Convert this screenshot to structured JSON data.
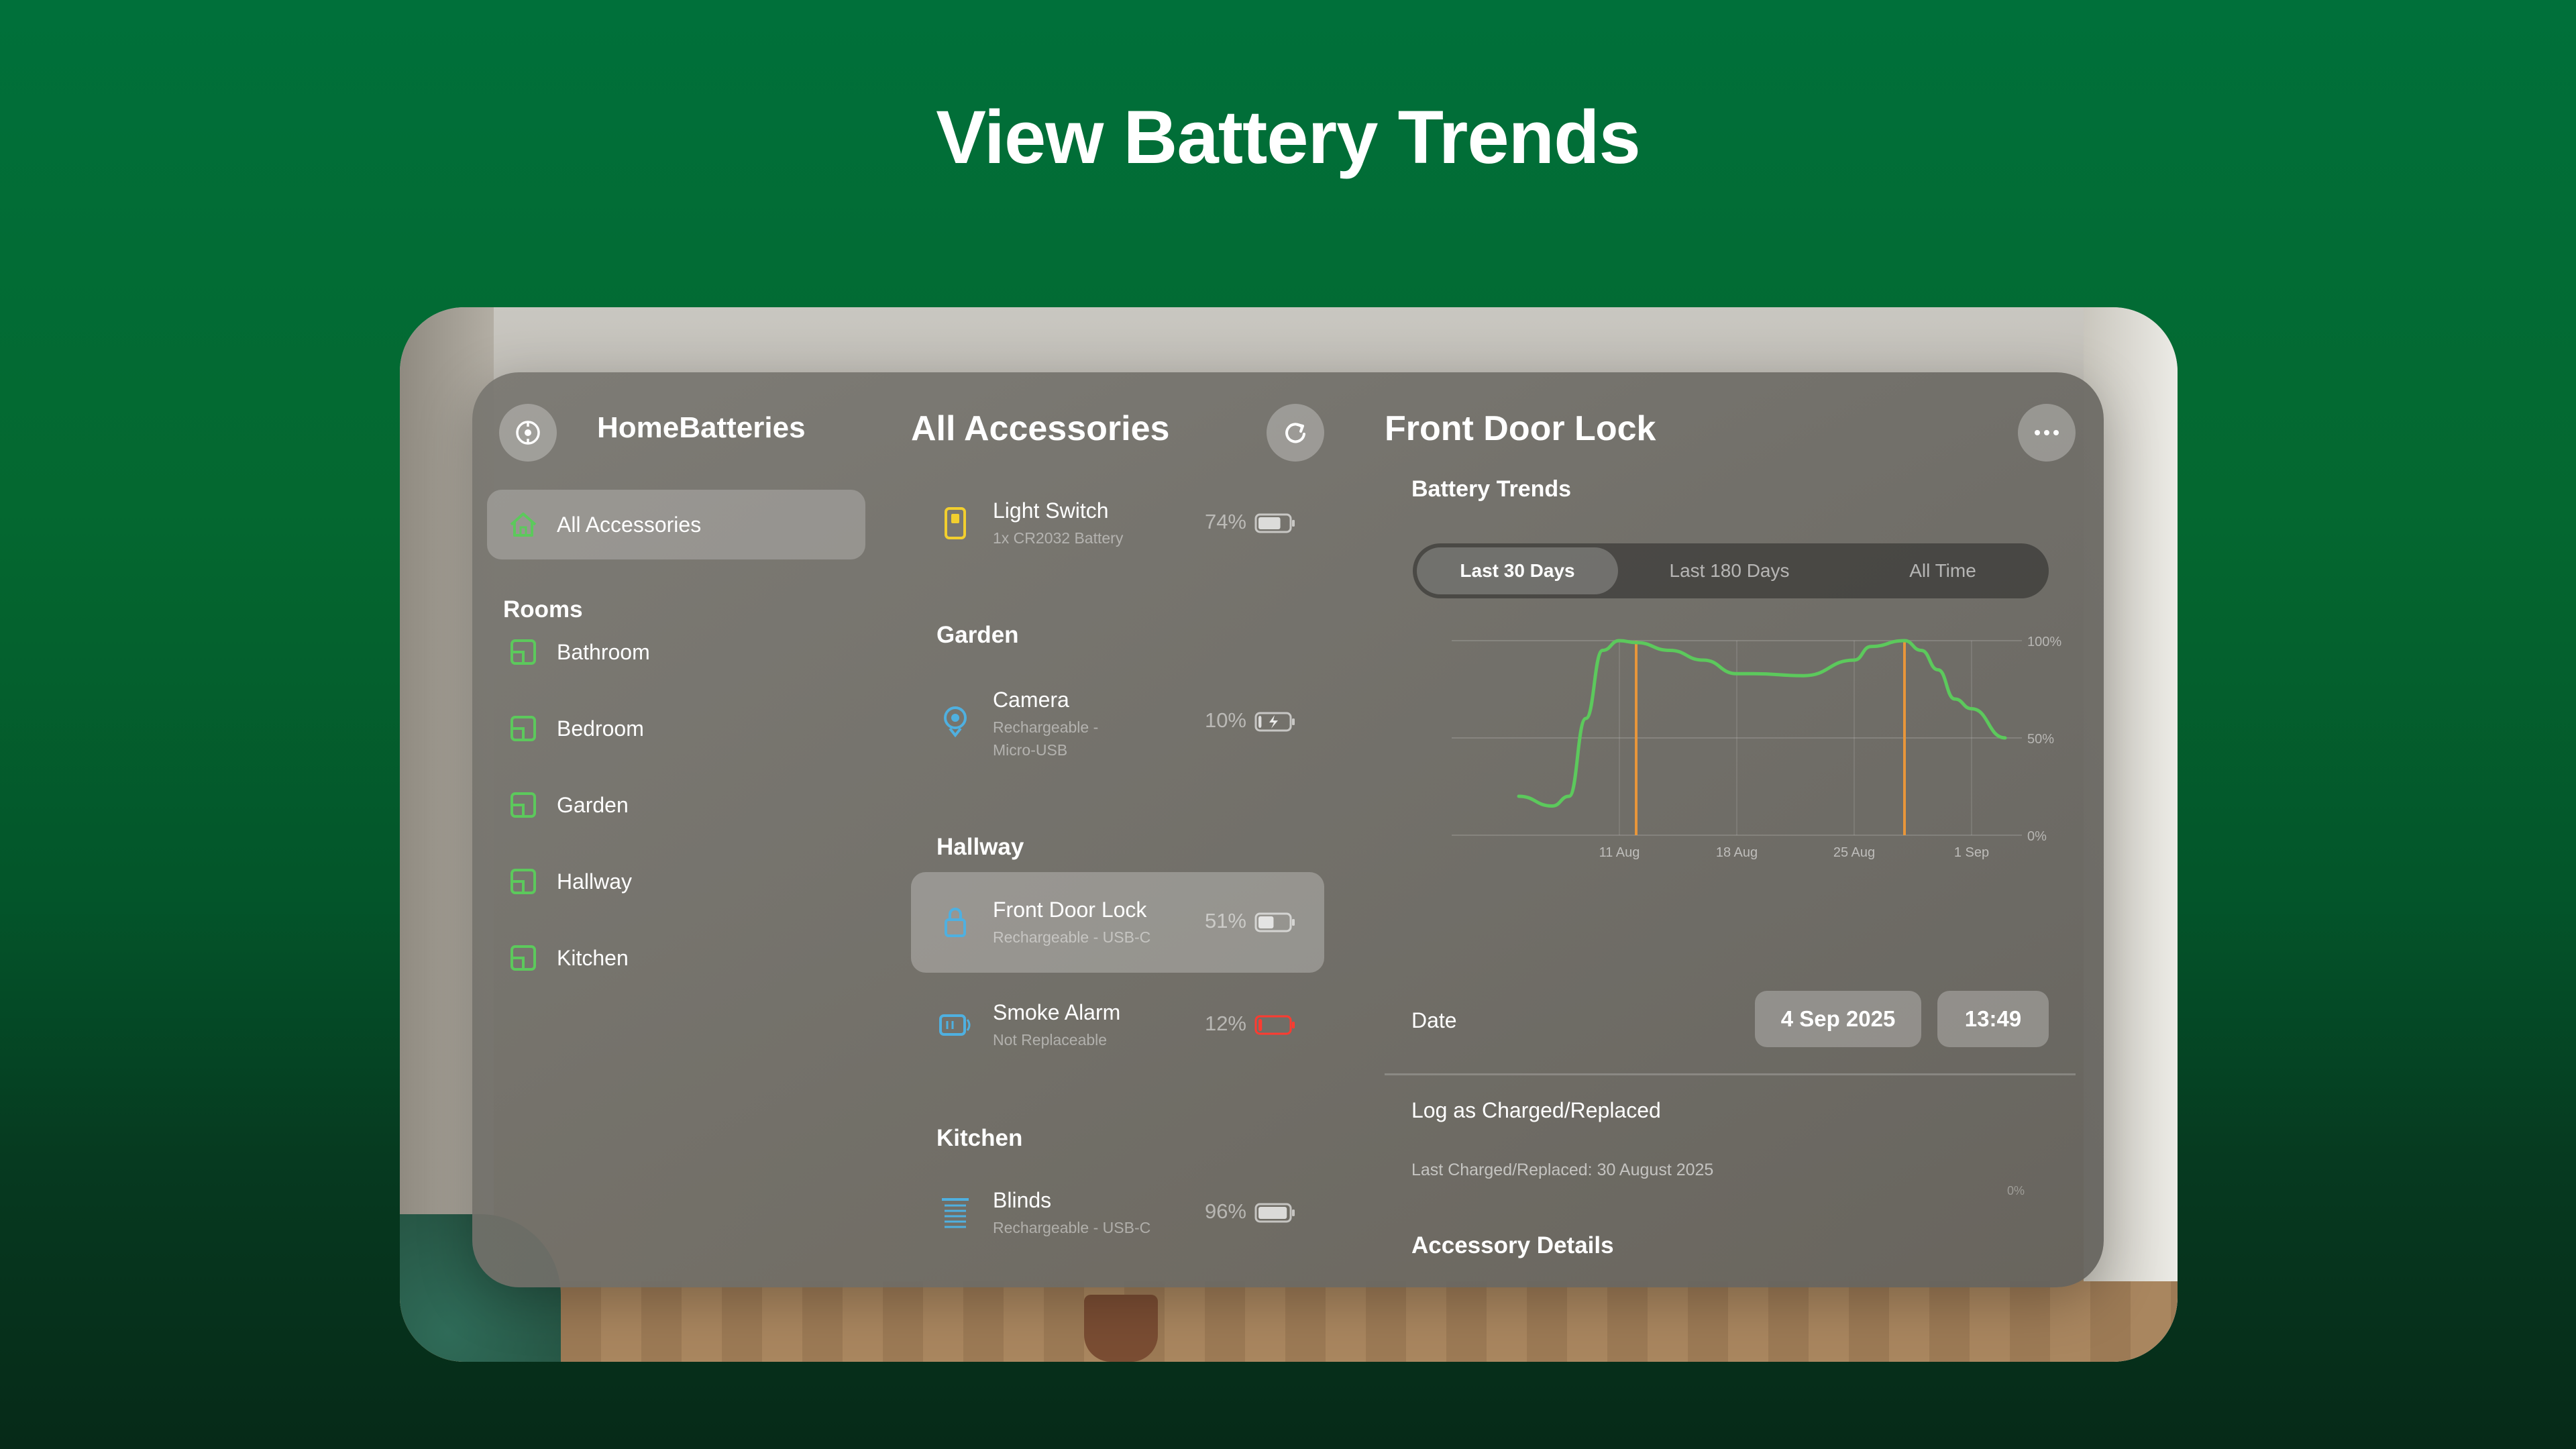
{
  "headline": "View Battery Trends",
  "sidebar": {
    "app_title": "HomeBatteries",
    "all_accessories": "All Accessories",
    "rooms_heading": "Rooms",
    "rooms": [
      "Bathroom",
      "Bedroom",
      "Garden",
      "Hallway",
      "Kitchen"
    ]
  },
  "list": {
    "title": "All Accessories",
    "sections": {
      "garden": "Garden",
      "hallway": "Hallway",
      "kitchen": "Kitchen"
    },
    "items": [
      {
        "name": "Light Switch",
        "sub": "1x CR2032 Battery",
        "pct": "74%",
        "level": 0.74,
        "icon": "light-switch-icon",
        "icon_color": "#f2cf2e"
      },
      {
        "name": "Camera",
        "sub": "Rechargeable - Micro-USB",
        "pct": "10%",
        "level": 0.1,
        "charging": true,
        "icon": "camera-icon",
        "icon_color": "#4fb0e0"
      },
      {
        "name": "Front Door Lock",
        "sub": "Rechargeable - USB-C",
        "pct": "51%",
        "level": 0.51,
        "icon": "lock-icon",
        "icon_color": "#4fb0e0"
      },
      {
        "name": "Smoke Alarm",
        "sub": "Not Replaceable",
        "pct": "12%",
        "level": 0.12,
        "low": true,
        "icon": "smoke-alarm-icon",
        "icon_color": "#4fb0e0"
      },
      {
        "name": "Blinds",
        "sub": "Rechargeable - USB-C",
        "pct": "96%",
        "level": 0.96,
        "icon": "blinds-icon",
        "icon_color": "#4fb0e0"
      }
    ]
  },
  "detail": {
    "title": "Front Door Lock",
    "battery_trends": "Battery Trends",
    "tabs": [
      "Last 30 Days",
      "Last 180 Days",
      "All Time"
    ],
    "active_tab": 0,
    "date_label": "Date",
    "date_value": "4 Sep 2025",
    "time_value": "13:49",
    "log_label": "Log as Charged/Replaced",
    "last_charged": "Last Charged/Replaced: 30 August 2025",
    "accessory_details": "Accessory Details",
    "partial_tick": "0%"
  },
  "colors": {
    "accent_green": "#5cc95c",
    "marker_orange": "#e8963a",
    "alert_red": "#ff3b30"
  },
  "chart_data": {
    "type": "line",
    "x_ticks": [
      "11 Aug",
      "18 Aug",
      "25 Aug",
      "1 Sep"
    ],
    "y_ticks": [
      "0%",
      "50%",
      "100%"
    ],
    "ylim": [
      0,
      100
    ],
    "grid": true,
    "series": [
      {
        "x": [
          "5 Aug",
          "7 Aug",
          "8 Aug",
          "9 Aug",
          "10 Aug",
          "11 Aug",
          "12 Aug",
          "14 Aug",
          "16 Aug",
          "18 Aug",
          "19 Aug",
          "22 Aug",
          "25 Aug",
          "26 Aug",
          "28 Aug",
          "29 Aug",
          "30 Aug",
          "31 Aug",
          "1 Sep",
          "3 Sep"
        ],
        "values": [
          20,
          15,
          20,
          60,
          95,
          100,
          99,
          95,
          90,
          83,
          83,
          82,
          90,
          97,
          100,
          95,
          85,
          70,
          65,
          50
        ]
      }
    ],
    "charge_events": [
      "12 Aug",
      "28 Aug"
    ]
  }
}
